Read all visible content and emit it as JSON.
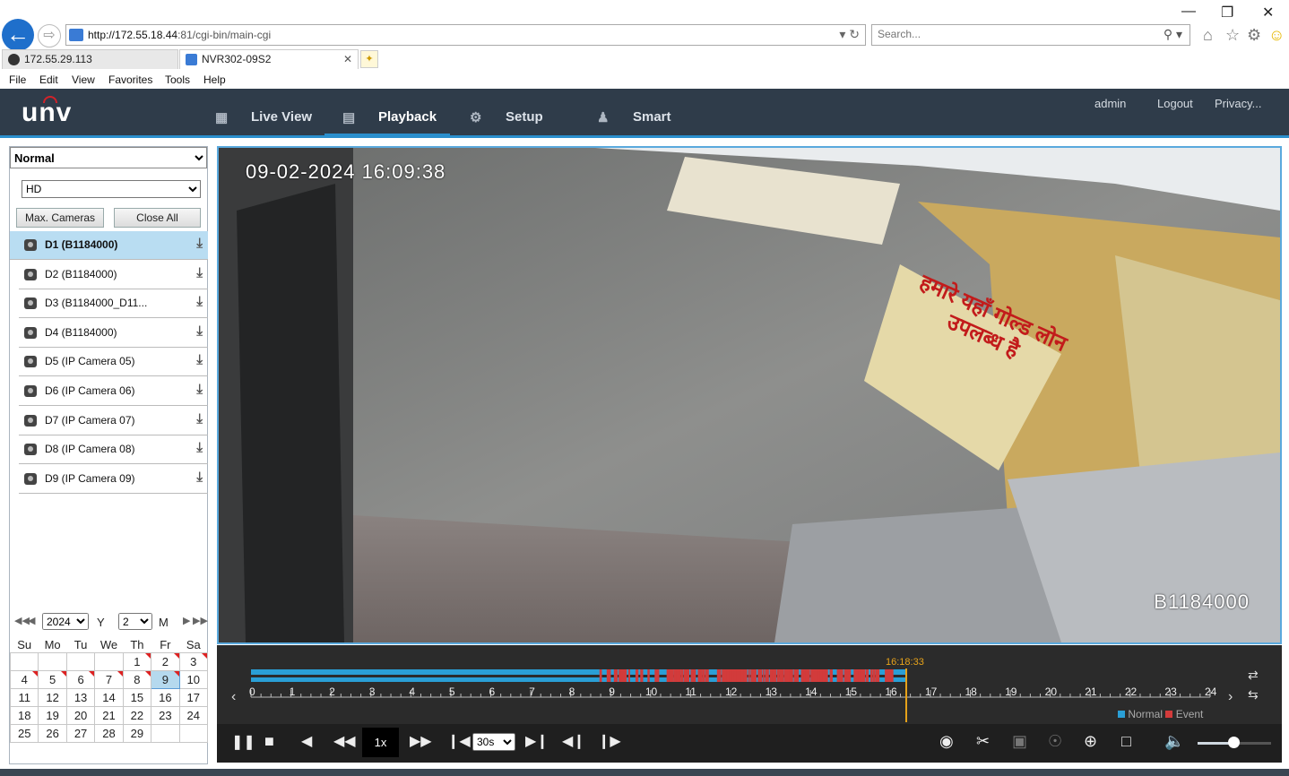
{
  "browser": {
    "url_host": "http://172.55.18.44",
    "url_path": ":81/cgi-bin/main-cgi",
    "search_placeholder": "Search...",
    "tabs": [
      {
        "label": "172.55.29.113"
      },
      {
        "label": "NVR302-09S2"
      }
    ],
    "menu": [
      "File",
      "Edit",
      "View",
      "Favorites",
      "Tools",
      "Help"
    ]
  },
  "app": {
    "logo": "unv",
    "nav": [
      {
        "label": "Live View",
        "icon": "monitor-icon"
      },
      {
        "label": "Playback",
        "icon": "film-icon"
      },
      {
        "label": "Setup",
        "icon": "gear-icon"
      },
      {
        "label": "Smart",
        "icon": "person-icon"
      }
    ],
    "active_nav": "Playback",
    "user": {
      "name": "admin",
      "logout": "Logout",
      "privacy": "Privacy..."
    },
    "accent_color": "#2a8fcd"
  },
  "left_panel": {
    "mode": "Normal",
    "stream": "HD",
    "max_cameras": "Max. Cameras",
    "close_all": "Close All",
    "cameras": [
      {
        "label": "D1 (B1184000)",
        "selected": true
      },
      {
        "label": "D2 (B1184000)"
      },
      {
        "label": "D3 (B1184000_D11..."
      },
      {
        "label": "D4 (B1184000)"
      },
      {
        "label": "D5 (IP Camera 05)"
      },
      {
        "label": "D6 (IP Camera 06)"
      },
      {
        "label": "D7 (IP Camera 07)"
      },
      {
        "label": "D8 (IP Camera 08)"
      },
      {
        "label": "D9 (IP Camera 09)"
      }
    ],
    "calendar": {
      "year": "2024",
      "year_label": "Y",
      "month": "2",
      "month_label": "M",
      "weekdays": [
        "Su",
        "Mo",
        "Tu",
        "We",
        "Th",
        "Fr",
        "Sa"
      ],
      "weeks": [
        [
          "",
          "",
          "",
          "",
          "1",
          "2",
          "3"
        ],
        [
          "4",
          "5",
          "6",
          "7",
          "8",
          "9",
          "10"
        ],
        [
          "11",
          "12",
          "13",
          "14",
          "15",
          "16",
          "17"
        ],
        [
          "18",
          "19",
          "20",
          "21",
          "22",
          "23",
          "24"
        ],
        [
          "25",
          "26",
          "27",
          "28",
          "29",
          "",
          ""
        ]
      ],
      "recorded_days": [
        "1",
        "2",
        "3",
        "4",
        "5",
        "6",
        "7",
        "8",
        "9"
      ],
      "selected_day": "9"
    }
  },
  "video": {
    "timestamp": "09-02-2024 16:09:38",
    "camera_overlay": "B1184000",
    "poster_text": "हमारे यहाँ गोल्ड लोन उपलब्ध है"
  },
  "timeline": {
    "current_time": "16:18:33",
    "hours": [
      "0",
      "1",
      "2",
      "3",
      "4",
      "5",
      "6",
      "7",
      "8",
      "9",
      "10",
      "11",
      "12",
      "13",
      "14",
      "15",
      "16",
      "17",
      "18",
      "19",
      "20",
      "21",
      "22",
      "23",
      "24"
    ],
    "legend_normal": "Normal",
    "legend_event": "Event",
    "normal_color": "#2a9fd6",
    "event_color": "#d23b3b",
    "speed": "1x",
    "interval": "30s",
    "volume": 0.5
  }
}
